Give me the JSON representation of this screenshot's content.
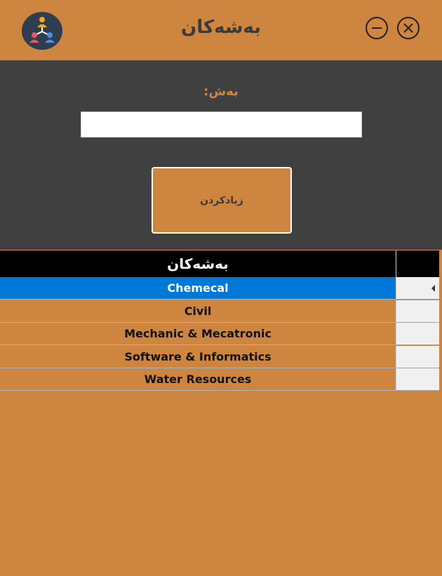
{
  "window": {
    "title": "بەشەکان",
    "logo_icon": "org-chart-people-icon",
    "minimize_icon": "minus-circle-icon",
    "close_icon": "x-circle-icon"
  },
  "form": {
    "field_label": "بەش:",
    "department_value": "",
    "add_button_label": "زیادکردن"
  },
  "grid": {
    "column_header": "بەشەکان",
    "rows": [
      {
        "name": "Chemecal",
        "selected": true
      },
      {
        "name": "Civil",
        "selected": false
      },
      {
        "name": "Mechanic & Mecatronic",
        "selected": false
      },
      {
        "name": "Software & Informatics",
        "selected": false
      },
      {
        "name": "Water Resources",
        "selected": false
      }
    ]
  },
  "colors": {
    "background": "#cd853f",
    "panel": "#404040",
    "header": "#000000",
    "selection": "#0078d7",
    "text": "#3a3a3a"
  }
}
